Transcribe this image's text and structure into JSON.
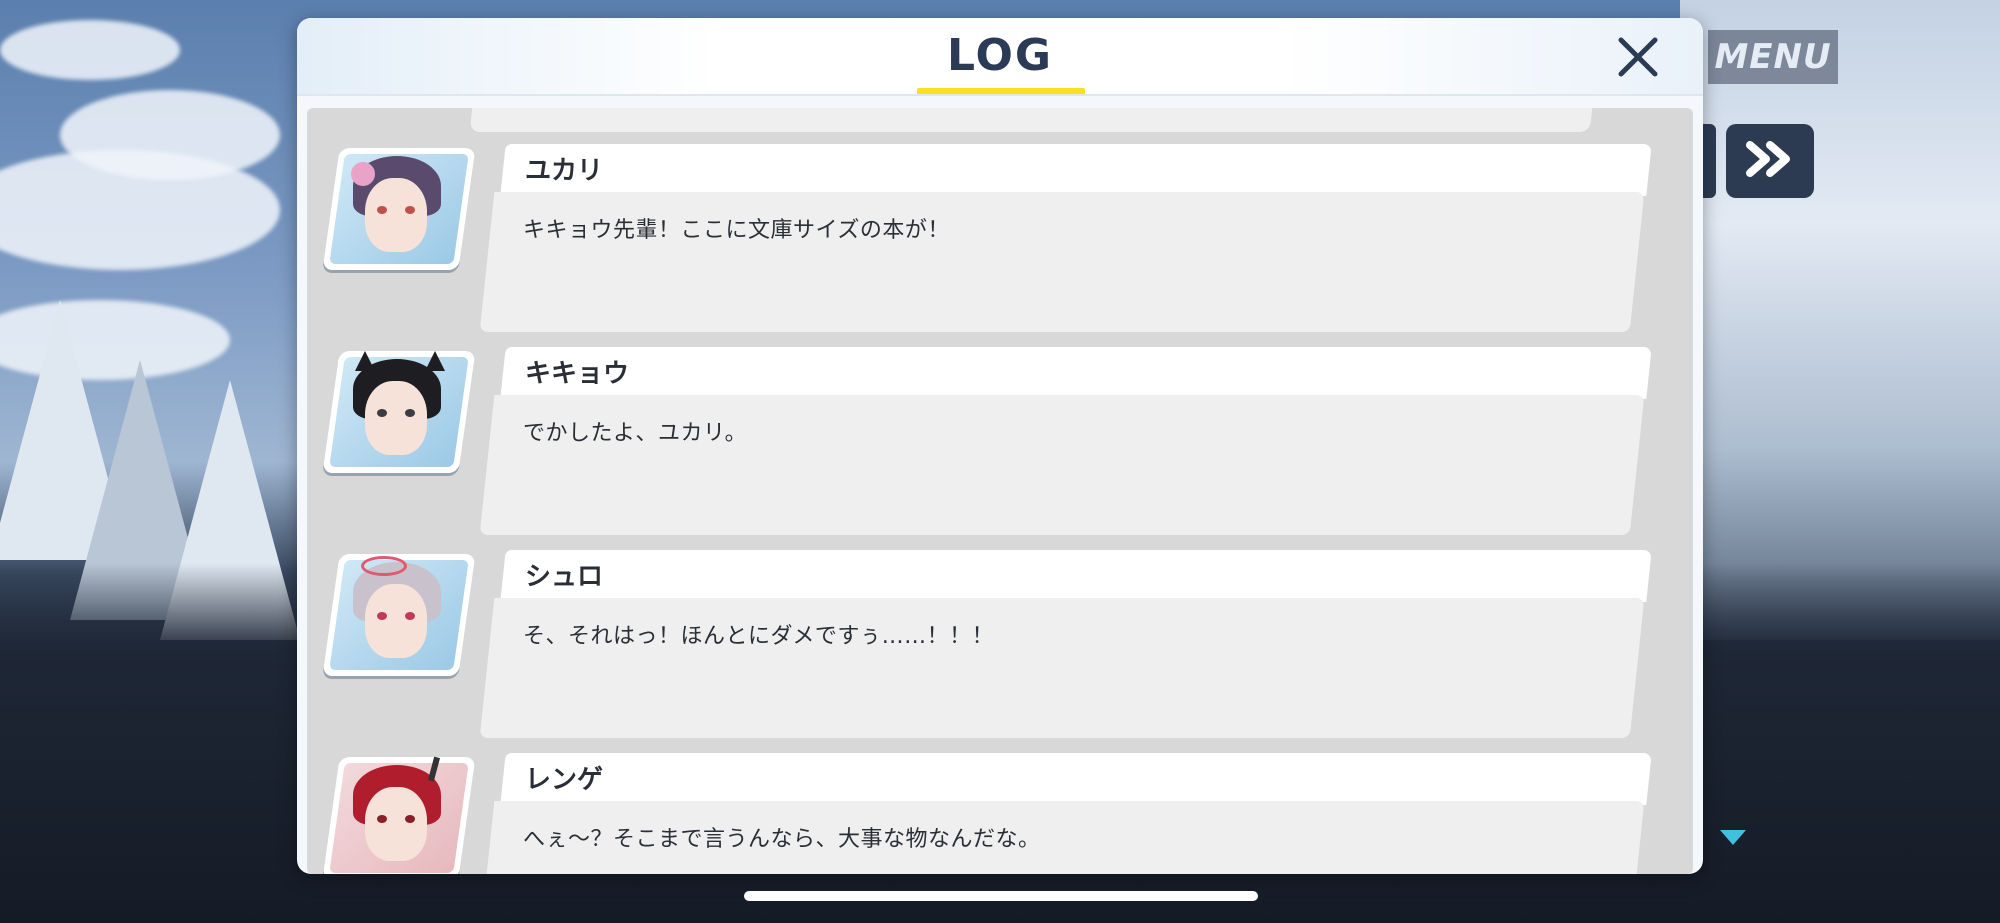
{
  "window": {
    "title": "LOG"
  },
  "overlay_controls": {
    "menu_label": "MENU",
    "skip_icon": "double-chevron-right-icon",
    "more_indicator_icon": "triangle-down-icon"
  },
  "panel": {
    "close_icon": "close-icon",
    "accent_color": "#f6e21f"
  },
  "log_entries": [
    {
      "speaker": "ユカリ",
      "text": "キキョウ先輩！ここに文庫サイズの本が！",
      "avatar_icon": "character-portrait-yukari"
    },
    {
      "speaker": "キキョウ",
      "text": "でかしたよ、ユカリ。",
      "avatar_icon": "character-portrait-kikyou"
    },
    {
      "speaker": "シュロ",
      "text": "そ、それはっ！ほんとにダメですぅ……！！！",
      "avatar_icon": "character-portrait-shuro"
    },
    {
      "speaker": "レンゲ",
      "text": "へぇ～？そこまで言うんなら、大事な物なんだな。",
      "avatar_icon": "character-portrait-renge"
    }
  ]
}
